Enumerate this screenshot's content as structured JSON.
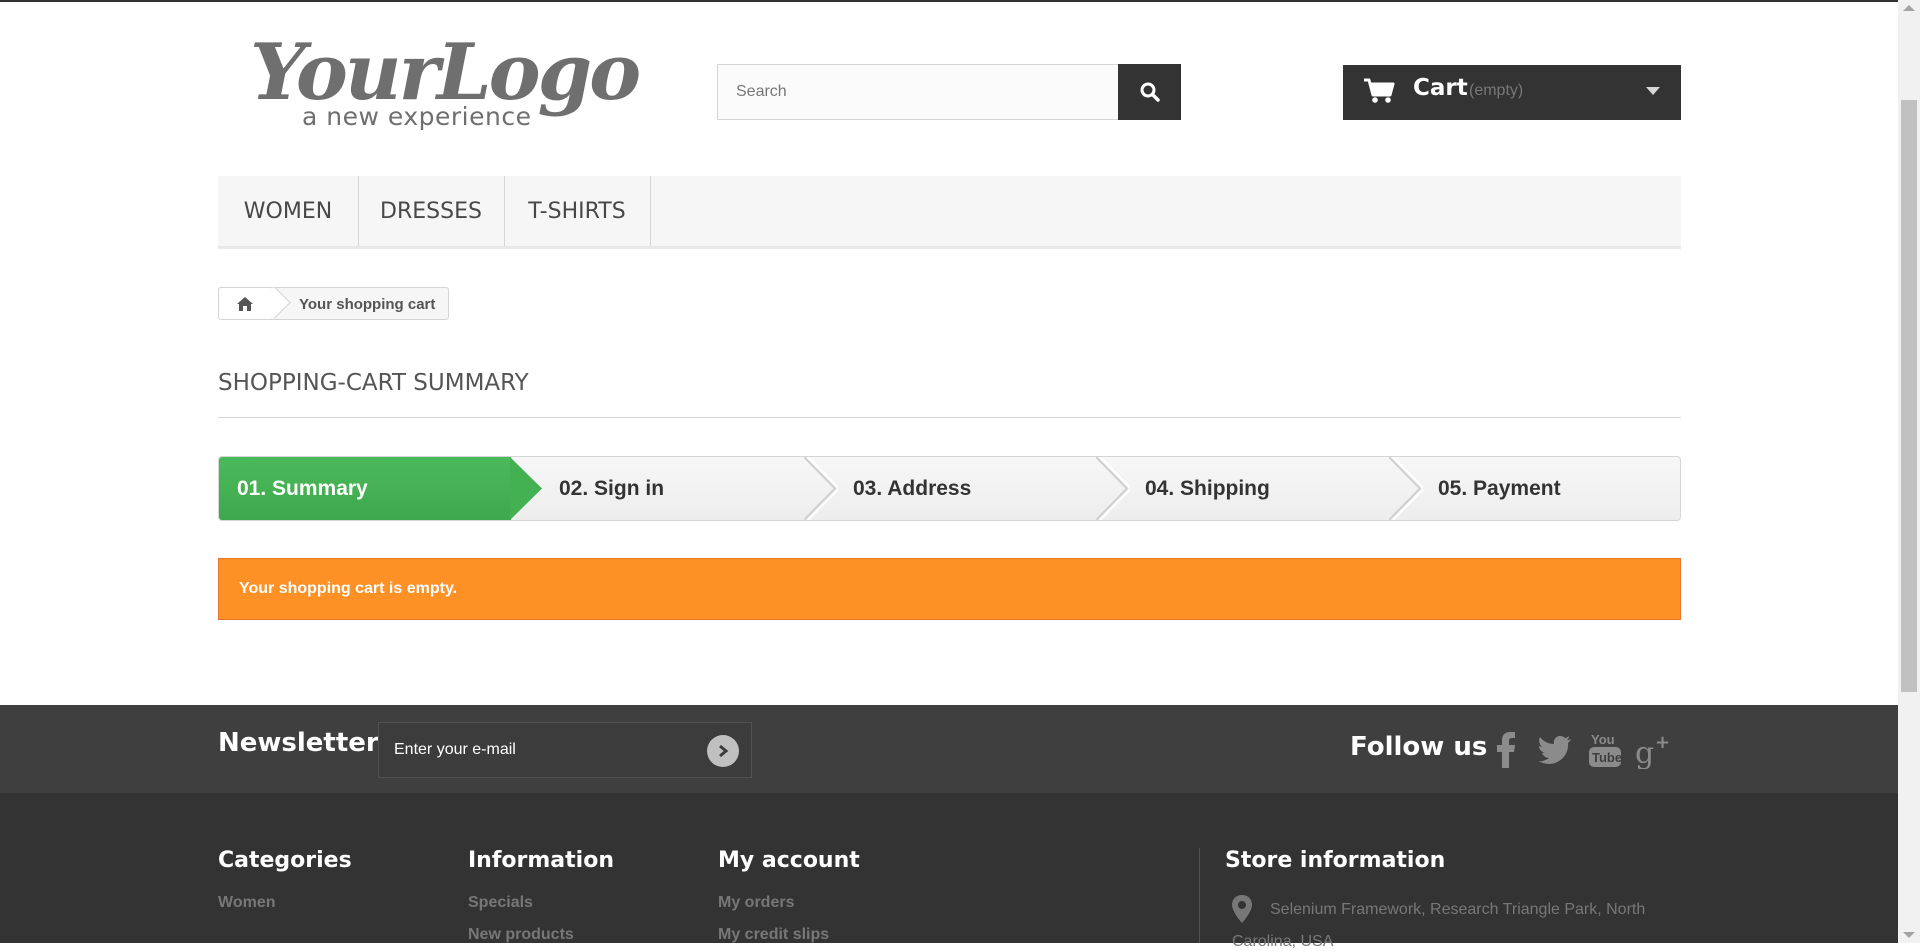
{
  "header": {
    "logo": {
      "wordmark": "YourLogo",
      "tagline": "a new experience"
    },
    "search": {
      "placeholder": "Search"
    },
    "cart": {
      "label": "Cart",
      "state": "(empty)"
    }
  },
  "menu": {
    "items": [
      {
        "label": "WOMEN"
      },
      {
        "label": "DRESSES"
      },
      {
        "label": "T-SHIRTS"
      }
    ]
  },
  "breadcrumb": {
    "current": "Your shopping cart"
  },
  "page": {
    "title": "SHOPPING-CART SUMMARY"
  },
  "steps": [
    {
      "label": "01. Summary",
      "active": true
    },
    {
      "label": "02. Sign in",
      "active": false
    },
    {
      "label": "03. Address",
      "active": false
    },
    {
      "label": "04. Shipping",
      "active": false
    },
    {
      "label": "05. Payment",
      "active": false
    }
  ],
  "alert": {
    "message": "Your shopping cart is empty."
  },
  "newsletter": {
    "title": "Newsletter",
    "placeholder": "Enter your e-mail"
  },
  "follow": {
    "title": "Follow us",
    "networks": [
      "facebook-icon",
      "twitter-icon",
      "youtube-icon",
      "google-plus-icon"
    ]
  },
  "footer": {
    "categories": {
      "title": "Categories",
      "links": [
        "Women"
      ]
    },
    "information": {
      "title": "Information",
      "links": [
        "Specials",
        "New products"
      ]
    },
    "account": {
      "title": "My account",
      "links": [
        "My orders",
        "My credit slips"
      ]
    },
    "store": {
      "title": "Store information",
      "address_line1": "Selenium Framework, Research Triangle Park, North",
      "address_line2": "Carolina, USA"
    }
  },
  "colors": {
    "accent_green": "#46b556",
    "alert_orange": "#fe9126",
    "dark": "#333333",
    "footer_bar": "#3f3f3f"
  }
}
